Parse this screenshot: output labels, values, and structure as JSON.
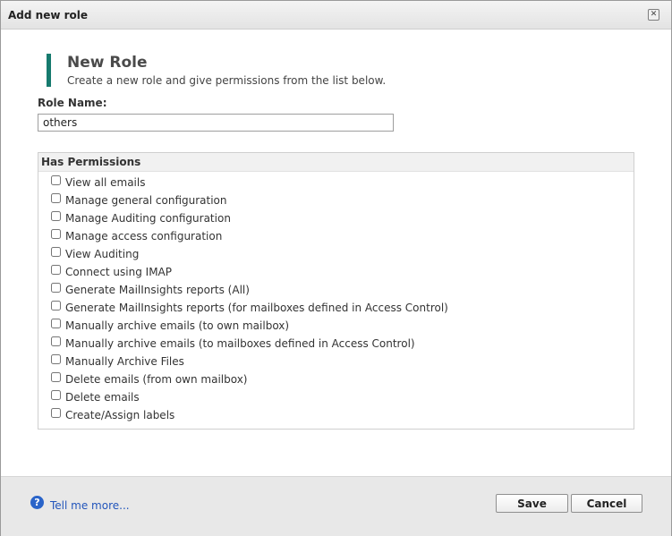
{
  "dialog": {
    "title": "Add new role",
    "close_icon": "close-icon"
  },
  "header": {
    "title": "New Role",
    "subtitle": "Create a new role and give permissions from the list below."
  },
  "form": {
    "role_name_label": "Role Name:",
    "role_name_value": "others",
    "permissions_title": "Has Permissions",
    "permissions": [
      {
        "label": "View all emails",
        "checked": false
      },
      {
        "label": "Manage general configuration",
        "checked": false
      },
      {
        "label": "Manage Auditing configuration",
        "checked": false
      },
      {
        "label": "Manage access configuration",
        "checked": false
      },
      {
        "label": "View Auditing",
        "checked": false
      },
      {
        "label": "Connect using IMAP",
        "checked": false
      },
      {
        "label": "Generate MailInsights reports (All)",
        "checked": false
      },
      {
        "label": "Generate MailInsights reports (for mailboxes defined in Access Control)",
        "checked": false
      },
      {
        "label": "Manually archive emails (to own mailbox)",
        "checked": false
      },
      {
        "label": "Manually archive emails (to mailboxes defined in Access Control)",
        "checked": false
      },
      {
        "label": "Manually Archive Files",
        "checked": false
      },
      {
        "label": "Delete emails (from own mailbox)",
        "checked": false
      },
      {
        "label": "Delete emails",
        "checked": false
      },
      {
        "label": "Create/Assign labels",
        "checked": false
      }
    ]
  },
  "footer": {
    "help_icon": "help-icon",
    "help_link": "Tell me more...",
    "save_label": "Save",
    "cancel_label": "Cancel"
  },
  "colors": {
    "accent": "#167a6e",
    "link": "#2255bb",
    "help_icon_bg": "#2a64c9"
  }
}
